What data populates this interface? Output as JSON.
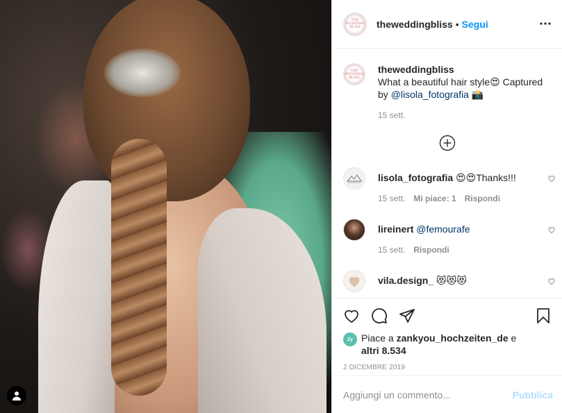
{
  "header": {
    "username": "theweddingbliss",
    "separator": "•",
    "follow_label": "Segui",
    "more_icon": "more-dots-icon"
  },
  "caption": {
    "username": "theweddingbliss",
    "text_before": "What a beautiful hair style",
    "emoji1": "😍",
    "text_mid": " Captured by ",
    "mention": "@lisola_fotografia",
    "emoji2": " 📸",
    "date": "15 sett."
  },
  "load_more_icon": "plus-circle-icon",
  "comments": [
    {
      "username": "lisola_fotografia",
      "text": "😍😍Thanks!!!",
      "date": "15 sett.",
      "likes": "Mi piace: 1",
      "reply": "Rispondi"
    },
    {
      "username": "lireinert",
      "mention": "@femourafe",
      "date": "15 sett.",
      "reply": "Rispondi"
    },
    {
      "username": "vila.design_",
      "text": "😻😻😻"
    }
  ],
  "likes": {
    "prefix": "Piace a ",
    "user": "zankyou_hochzeiten_de",
    "mid": " e ",
    "others": "altri 8.534",
    "avatar_text": "Zy"
  },
  "post_date": "2 dicembre 2019",
  "add_comment": {
    "placeholder": "Aggiungi un commento...",
    "publish_label": "Pubblica"
  },
  "avatar_text": "THE WEDDING BLISS",
  "colors": {
    "link": "#0095f6",
    "mention": "#00376b",
    "publish_disabled": "#b2dffc",
    "muted": "#8e8e8e"
  }
}
